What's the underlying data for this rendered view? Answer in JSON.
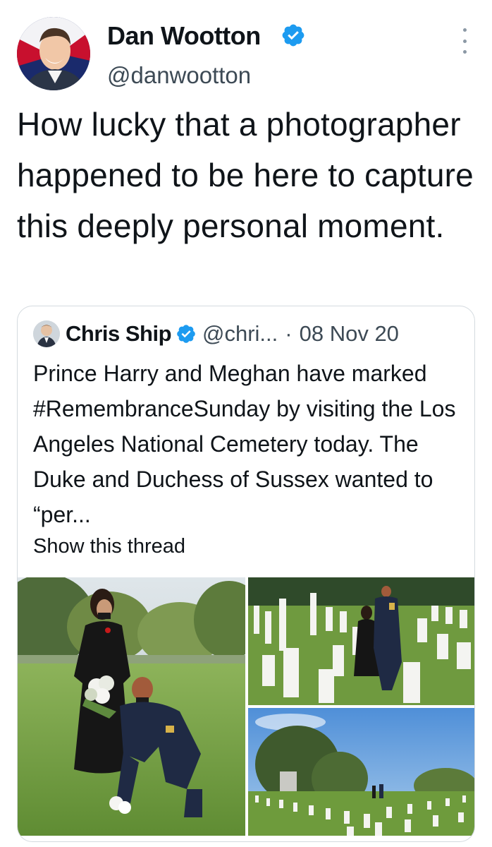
{
  "tweet": {
    "author_name": "Dan Wootton",
    "handle": "@danwootton",
    "text": "How lucky that a photographer happened to be here to capture this deeply personal moment."
  },
  "quoted": {
    "author_name": "Chris Ship",
    "handle": "@chri...",
    "separator": "·",
    "date": "08 Nov 20",
    "text": "Prince Harry and Meghan have marked #RemembranceSunday by visiting the Los Angeles National Cemetery today. The Duke and Duchess of Sussex wanted to “per...",
    "show_thread": "Show this thread"
  },
  "icons": {
    "verified": "verified-badge-icon",
    "more": "more-options-icon"
  },
  "colors": {
    "verified_blue": "#1d9bf0",
    "text": "#0f1419",
    "secondary": "#536471",
    "border": "#d4dadf"
  }
}
